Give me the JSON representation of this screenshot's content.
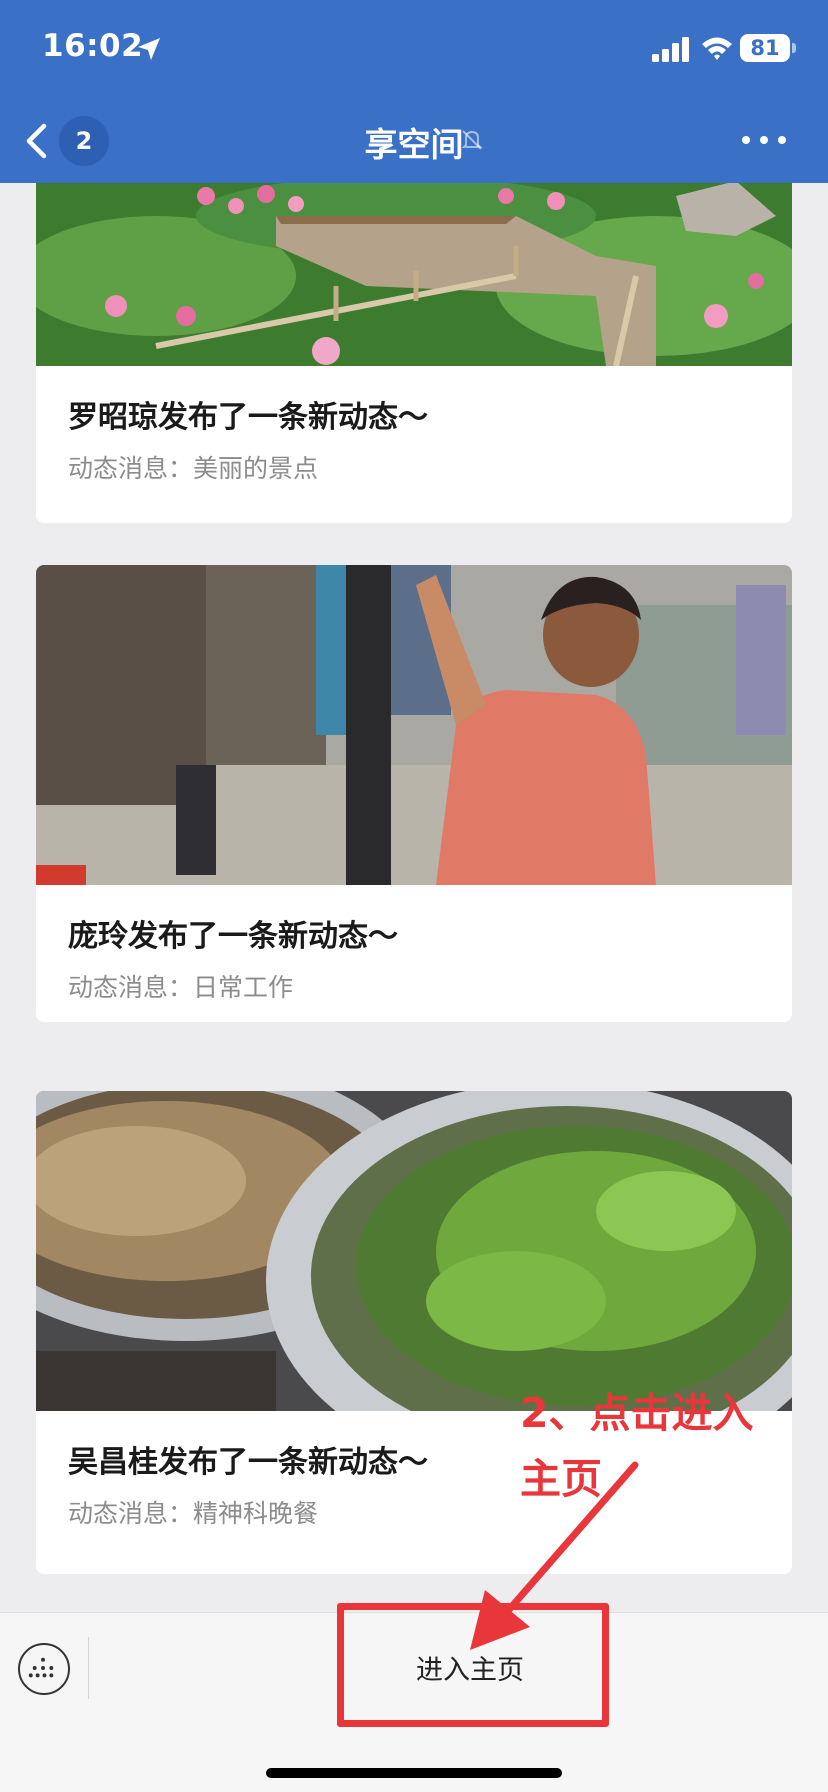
{
  "status_bar": {
    "time": "16:02",
    "battery": "81"
  },
  "nav": {
    "back_count": "2",
    "title": "享空间"
  },
  "feed": {
    "cards": [
      {
        "title": "罗昭琼发布了一条新动态～",
        "subtitle": "动态消息：美丽的景点",
        "image": "lotus-pond-photo"
      },
      {
        "title": "庞玲发布了一条新动态～",
        "subtitle": "动态消息：日常工作",
        "image": "hanging-laundry-photo"
      },
      {
        "title": "吴昌桂发布了一条新动态～",
        "subtitle": "动态消息：精神科晚餐",
        "image": "food-pots-photo"
      }
    ]
  },
  "bottom_bar": {
    "home_label": "进入主页"
  },
  "annotation": {
    "line1": "2、点击进入",
    "line2": "主页"
  },
  "colors": {
    "header": "#3a70c6",
    "annotation": "#e9363a"
  }
}
